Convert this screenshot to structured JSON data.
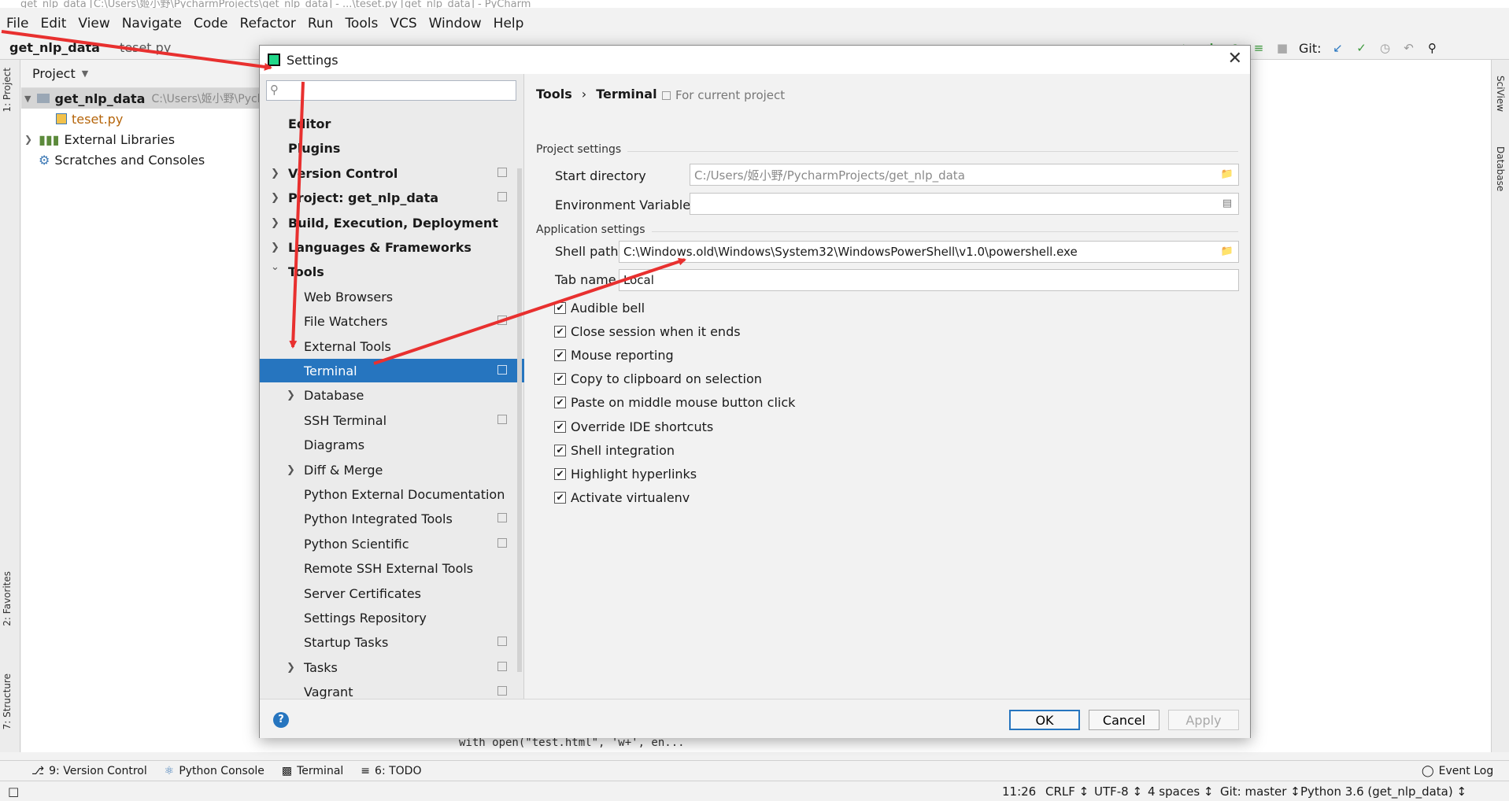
{
  "ide": {
    "title": "get_nlp_data [C:\\Users\\姬小野\\PycharmProjects\\get_nlp_data] - ...\\teset.py [get_nlp_data] - PyCharm",
    "menu": [
      "File",
      "Edit",
      "View",
      "Navigate",
      "Code",
      "Refactor",
      "Run",
      "Tools",
      "VCS",
      "Window",
      "Help"
    ],
    "breadcrumb_project": "get_nlp_data",
    "breadcrumb_file": "teset.py",
    "git_label": "Git:",
    "left_tabs": [
      "1: Project",
      "2: Favorites",
      "7: Structure"
    ],
    "right_tabs": [
      "SciView",
      "Database"
    ],
    "project_panel": {
      "header": "Project",
      "root_name": "get_nlp_data",
      "root_path": "C:\\Users\\姬小野\\Pych",
      "file": "teset.py",
      "external_libraries": "External Libraries",
      "scratches": "Scratches and Consoles"
    },
    "editor_code_snippet": "with open(\"test.html\", 'w+', en...",
    "tool_windows": [
      "9: Version Control",
      "Python Console",
      "Terminal",
      "6: TODO"
    ],
    "event_log": "Event Log",
    "status": {
      "position": "11:26",
      "line_sep": "CRLF ↕",
      "encoding": "UTF-8 ↕",
      "indent": "4 spaces ↕",
      "git": "Git: master ↕",
      "interpreter": "Python 3.6 (get_nlp_data) ↕"
    }
  },
  "dialog": {
    "title": "Settings",
    "search_placeholder": "",
    "nav": [
      {
        "label": "Editor",
        "level": 0,
        "bold": true,
        "chevron": false,
        "copy": false
      },
      {
        "label": "Plugins",
        "level": 0,
        "bold": true,
        "chevron": false,
        "copy": false
      },
      {
        "label": "Version Control",
        "level": 0,
        "bold": true,
        "chevron": "right",
        "copy": true
      },
      {
        "label": "Project: get_nlp_data",
        "level": 0,
        "bold": true,
        "chevron": "right",
        "copy": true
      },
      {
        "label": "Build, Execution, Deployment",
        "level": 0,
        "bold": true,
        "chevron": "right",
        "copy": false
      },
      {
        "label": "Languages & Frameworks",
        "level": 0,
        "bold": true,
        "chevron": "right",
        "copy": false
      },
      {
        "label": "Tools",
        "level": 0,
        "bold": true,
        "chevron": "down",
        "copy": false
      },
      {
        "label": "Web Browsers",
        "level": 1,
        "bold": false,
        "chevron": false,
        "copy": false
      },
      {
        "label": "File Watchers",
        "level": 1,
        "bold": false,
        "chevron": false,
        "copy": true
      },
      {
        "label": "External Tools",
        "level": 1,
        "bold": false,
        "chevron": false,
        "copy": false
      },
      {
        "label": "Terminal",
        "level": 1,
        "bold": false,
        "chevron": false,
        "copy": true,
        "selected": true
      },
      {
        "label": "Database",
        "level": 1,
        "bold": false,
        "chevron": "right",
        "copy": false
      },
      {
        "label": "SSH Terminal",
        "level": 1,
        "bold": false,
        "chevron": false,
        "copy": true
      },
      {
        "label": "Diagrams",
        "level": 1,
        "bold": false,
        "chevron": false,
        "copy": false
      },
      {
        "label": "Diff & Merge",
        "level": 1,
        "bold": false,
        "chevron": "right",
        "copy": false
      },
      {
        "label": "Python External Documentation",
        "level": 1,
        "bold": false,
        "chevron": false,
        "copy": false
      },
      {
        "label": "Python Integrated Tools",
        "level": 1,
        "bold": false,
        "chevron": false,
        "copy": true
      },
      {
        "label": "Python Scientific",
        "level": 1,
        "bold": false,
        "chevron": false,
        "copy": true
      },
      {
        "label": "Remote SSH External Tools",
        "level": 1,
        "bold": false,
        "chevron": false,
        "copy": false
      },
      {
        "label": "Server Certificates",
        "level": 1,
        "bold": false,
        "chevron": false,
        "copy": false
      },
      {
        "label": "Settings Repository",
        "level": 1,
        "bold": false,
        "chevron": false,
        "copy": false
      },
      {
        "label": "Startup Tasks",
        "level": 1,
        "bold": false,
        "chevron": false,
        "copy": true
      },
      {
        "label": "Tasks",
        "level": 1,
        "bold": false,
        "chevron": "right",
        "copy": true
      },
      {
        "label": "Vagrant",
        "level": 1,
        "bold": false,
        "chevron": false,
        "copy": true
      }
    ],
    "breadcrumb": [
      "Tools",
      "›",
      "Terminal"
    ],
    "for_current_project": "For current project",
    "project_settings": {
      "header": "Project settings",
      "start_directory_label": "Start directory",
      "start_directory_value": "C:/Users/姬小野/PycharmProjects/get_nlp_data",
      "env_vars_label": "Environment Variables",
      "env_vars_value": ""
    },
    "app_settings": {
      "header": "Application settings",
      "shell_path_label": "Shell path",
      "shell_path_value": "C:\\Windows.old\\Windows\\System32\\WindowsPowerShell\\v1.0\\powershell.exe",
      "tab_name_label": "Tab name",
      "tab_name_value": "Local",
      "checkboxes": [
        {
          "label": "Audible bell",
          "checked": true
        },
        {
          "label": "Close session when it ends",
          "checked": true
        },
        {
          "label": "Mouse reporting",
          "checked": true
        },
        {
          "label": "Copy to clipboard on selection",
          "checked": true
        },
        {
          "label": "Paste on middle mouse button click",
          "checked": true
        },
        {
          "label": "Override IDE shortcuts",
          "checked": true
        },
        {
          "label": "Shell integration",
          "checked": true
        },
        {
          "label": "Highlight hyperlinks",
          "checked": true
        },
        {
          "label": "Activate virtualenv",
          "checked": true
        }
      ]
    },
    "buttons": {
      "help": "?",
      "ok": "OK",
      "cancel": "Cancel",
      "apply": "Apply"
    }
  },
  "colors": {
    "selection": "#2675bf",
    "annotation_arrow": "#e8302f"
  }
}
